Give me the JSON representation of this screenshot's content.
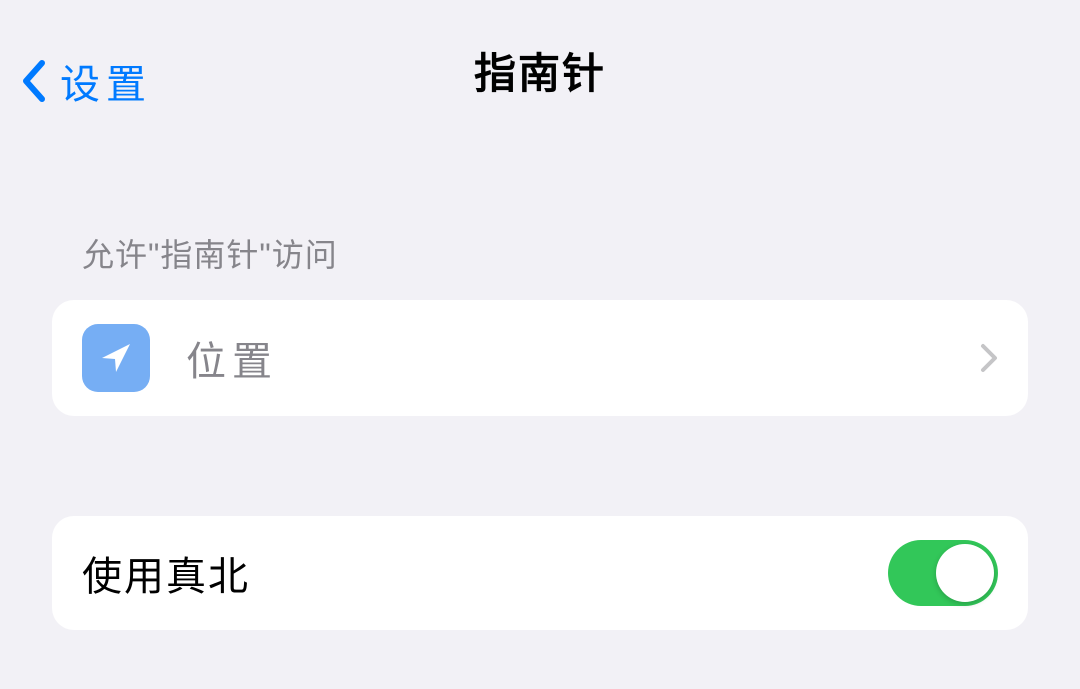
{
  "nav": {
    "back_label": "设置",
    "title": "指南针"
  },
  "section1": {
    "header": "允许\"指南针\"访问",
    "location_label": "位置"
  },
  "section2": {
    "true_north_label": "使用真北",
    "true_north_on": true
  },
  "colors": {
    "accent": "#007aff",
    "location_icon_bg": "#76aef4",
    "toggle_on": "#32c759"
  },
  "icons": {
    "back": "chevron-left-icon",
    "location": "location-arrow-icon",
    "disclosure": "chevron-right-icon"
  }
}
